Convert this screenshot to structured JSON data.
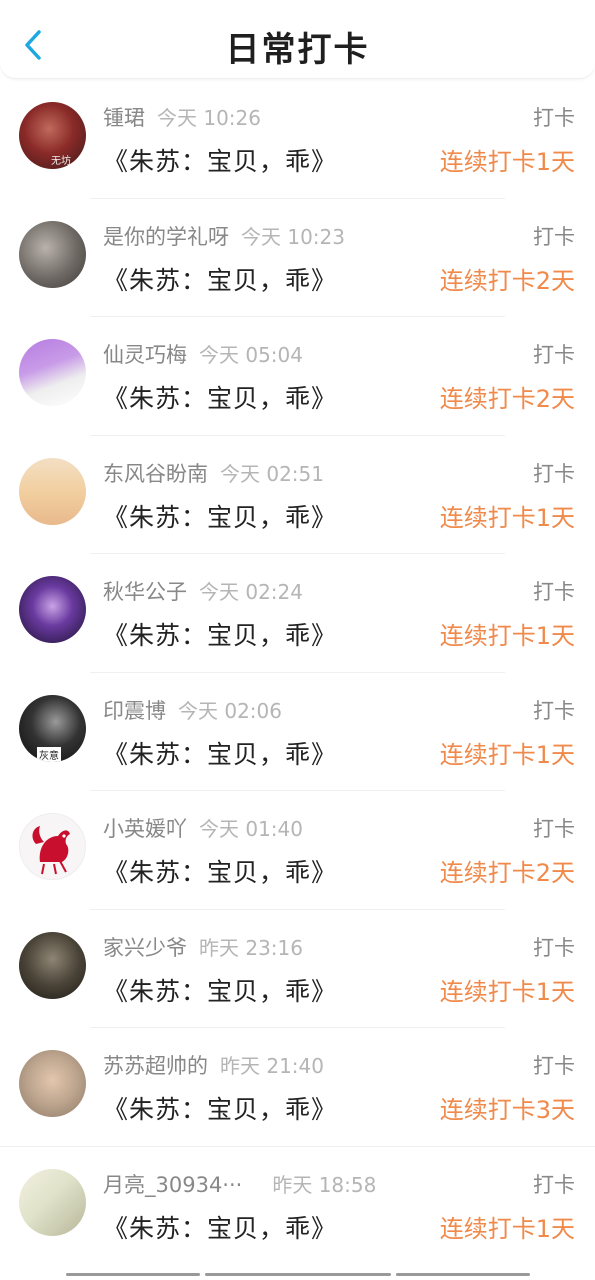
{
  "header": {
    "title": "日常打卡"
  },
  "icons": {
    "back": "chevron-left-icon"
  },
  "colors": {
    "accent": "#1ea7e1",
    "streak": "#f08a4b"
  },
  "items": [
    {
      "name": "锺珺",
      "time": "今天 10:26",
      "action": "打卡",
      "content": "《朱苏：宝贝，乖》",
      "streak": "连续打卡1天",
      "avatar_text": "无坊"
    },
    {
      "name": "是你的学礼呀",
      "time": "今天 10:23",
      "action": "打卡",
      "content": "《朱苏：宝贝，乖》",
      "streak": "连续打卡2天",
      "avatar_text": ""
    },
    {
      "name": "仙灵巧梅",
      "time": "今天 05:04",
      "action": "打卡",
      "content": "《朱苏：宝贝，乖》",
      "streak": "连续打卡2天",
      "avatar_text": ""
    },
    {
      "name": "东风谷盼南",
      "time": "今天 02:51",
      "action": "打卡",
      "content": "《朱苏：宝贝，乖》",
      "streak": "连续打卡1天",
      "avatar_text": ""
    },
    {
      "name": "秋华公子",
      "time": "今天 02:24",
      "action": "打卡",
      "content": "《朱苏：宝贝，乖》",
      "streak": "连续打卡1天",
      "avatar_text": ""
    },
    {
      "name": "印震博",
      "time": "今天 02:06",
      "action": "打卡",
      "content": "《朱苏：宝贝，乖》",
      "streak": "连续打卡1天",
      "avatar_text": "灰意"
    },
    {
      "name": "小英媛吖",
      "time": "今天 01:40",
      "action": "打卡",
      "content": "《朱苏：宝贝，乖》",
      "streak": "连续打卡2天",
      "avatar_text": ""
    },
    {
      "name": "家兴少爷",
      "time": "昨天 23:16",
      "action": "打卡",
      "content": "《朱苏：宝贝，乖》",
      "streak": "连续打卡1天",
      "avatar_text": ""
    },
    {
      "name": "苏苏超帅的",
      "time": "昨天 21:40",
      "action": "打卡",
      "content": "《朱苏：宝贝，乖》",
      "streak": "连续打卡3天",
      "avatar_text": ""
    },
    {
      "name": "月亮_30934···",
      "time": "昨天 18:58",
      "action": "打卡",
      "content": "《朱苏：宝贝，乖》",
      "streak": "连续打卡1天",
      "avatar_text": ""
    }
  ]
}
